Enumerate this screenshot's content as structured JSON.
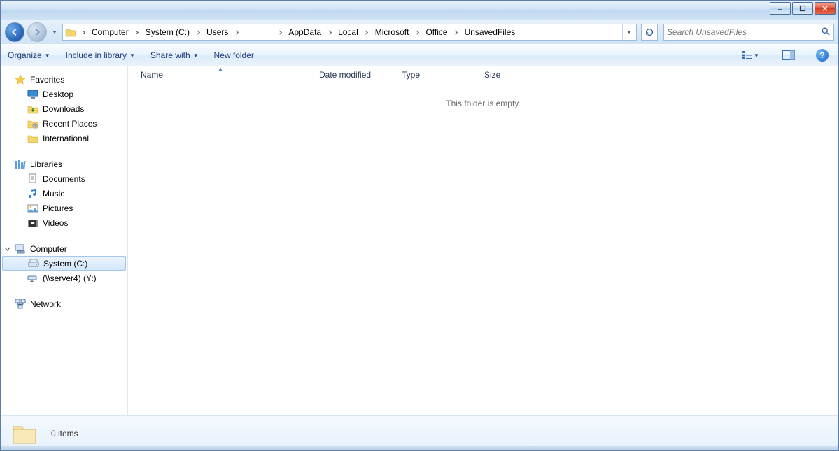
{
  "titlebar": {
    "min": "_",
    "max": "▢",
    "close": "✕"
  },
  "breadcrumbs": [
    "Computer",
    "System (C:)",
    "Users",
    "",
    "AppData",
    "Local",
    "Microsoft",
    "Office",
    "UnsavedFiles"
  ],
  "search": {
    "placeholder": "Search UnsavedFiles"
  },
  "toolbar": {
    "organize": "Organize",
    "include": "Include in library",
    "share": "Share with",
    "newfolder": "New folder"
  },
  "columns": {
    "name": "Name",
    "date": "Date modified",
    "type": "Type",
    "size": "Size"
  },
  "empty_message": "This folder is empty.",
  "sidebar": {
    "favorites": {
      "label": "Favorites",
      "items": [
        "Desktop",
        "Downloads",
        "Recent Places",
        "International"
      ]
    },
    "libraries": {
      "label": "Libraries",
      "items": [
        "Documents",
        "Music",
        "Pictures",
        "Videos"
      ]
    },
    "computer": {
      "label": "Computer",
      "items": [
        "System (C:)",
        "(\\\\server4) (Y:)"
      ]
    },
    "network": {
      "label": "Network"
    }
  },
  "status": {
    "count": "0 items"
  }
}
